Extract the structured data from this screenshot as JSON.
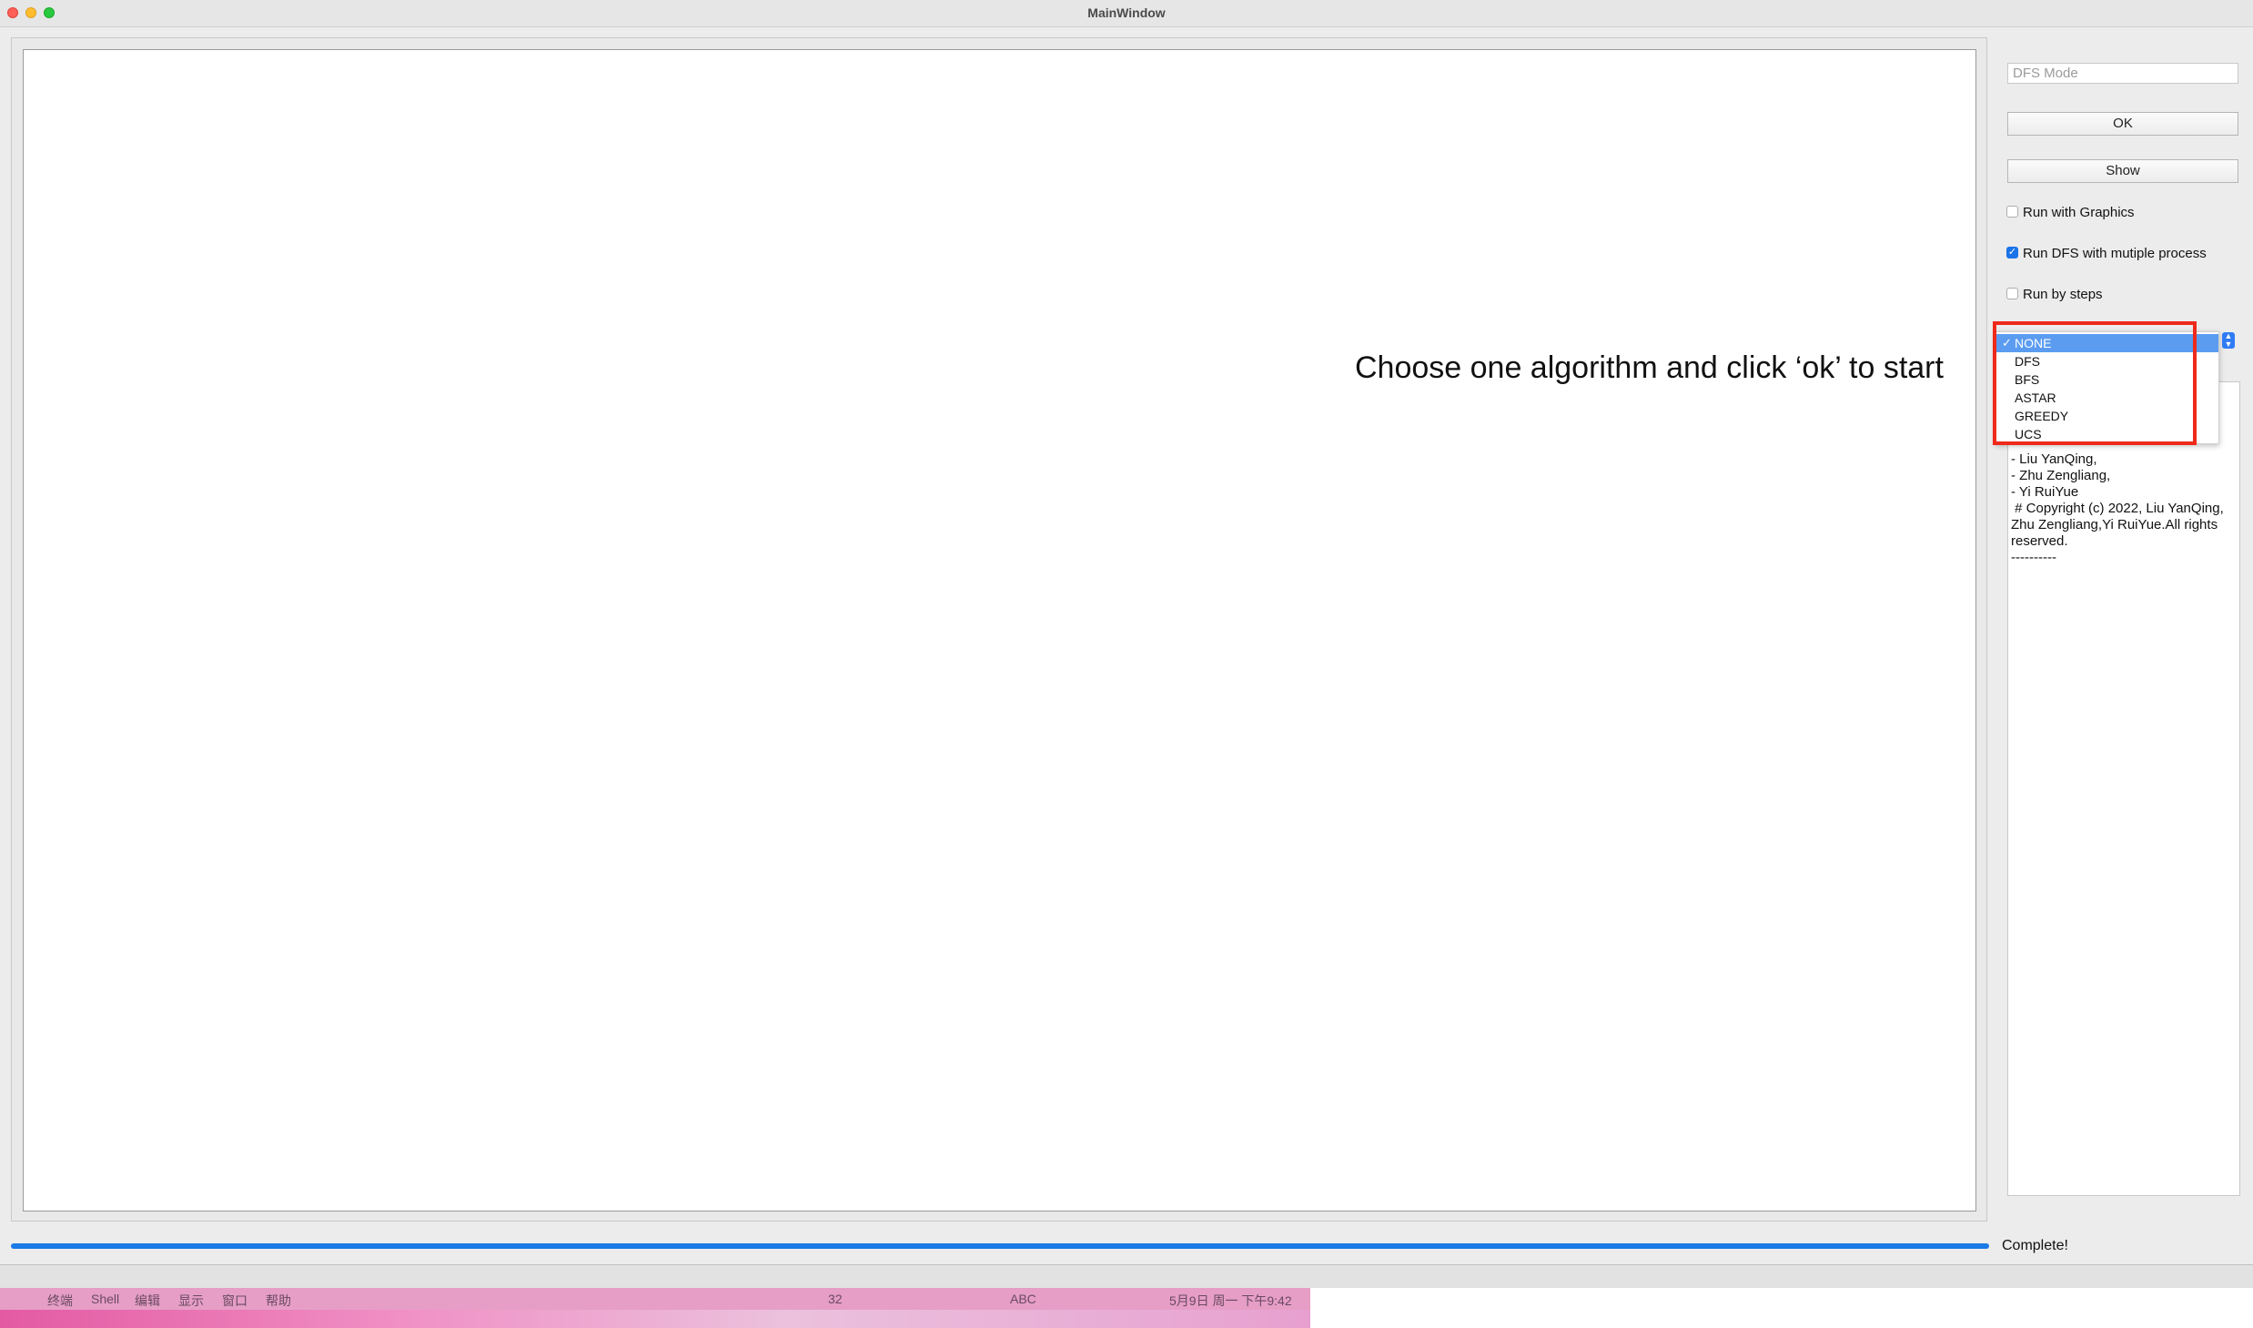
{
  "window": {
    "title": "MainWindow"
  },
  "canvas": {
    "instruction": "Choose one algorithm and click ‘ok’ to start"
  },
  "side": {
    "mode_placeholder": "DFS Mode",
    "ok_label": "OK",
    "show_label": "Show",
    "checkboxes": [
      {
        "label": "Run with Graphics",
        "checked": false
      },
      {
        "label": "Run DFS with mutiple process",
        "checked": true
      },
      {
        "label": "Run by steps",
        "checked": false
      }
    ],
    "algorithm_options": [
      {
        "label": "NONE",
        "selected": true
      },
      {
        "label": "DFS",
        "selected": false
      },
      {
        "label": "BFS",
        "selected": false
      },
      {
        "label": "ASTAR",
        "selected": false
      },
      {
        "label": "GREEDY",
        "selected": false
      },
      {
        "label": "UCS",
        "selected": false
      }
    ],
    "check_mark": "✓",
    "info_lines": [
      "- Liu YanQing,",
      "- Zhu Zengliang,",
      "- Yi RuiYue",
      " # Copyright (c) 2022, Liu YanQing, Zhu Zengliang,Yi RuiYue.All rights reserved.",
      "----------"
    ]
  },
  "progress": {
    "value": 1.0,
    "status_text": "Complete!"
  },
  "menubar": {
    "items": [
      "终端",
      "Shell",
      "编辑",
      "显示",
      "窗口",
      "帮助"
    ],
    "right_items": [
      "32",
      "ABC",
      "5月9日 周一 下午9:42"
    ]
  },
  "colors": {
    "accent": "#1a7ae6",
    "highlight": "#ee2a1b"
  }
}
